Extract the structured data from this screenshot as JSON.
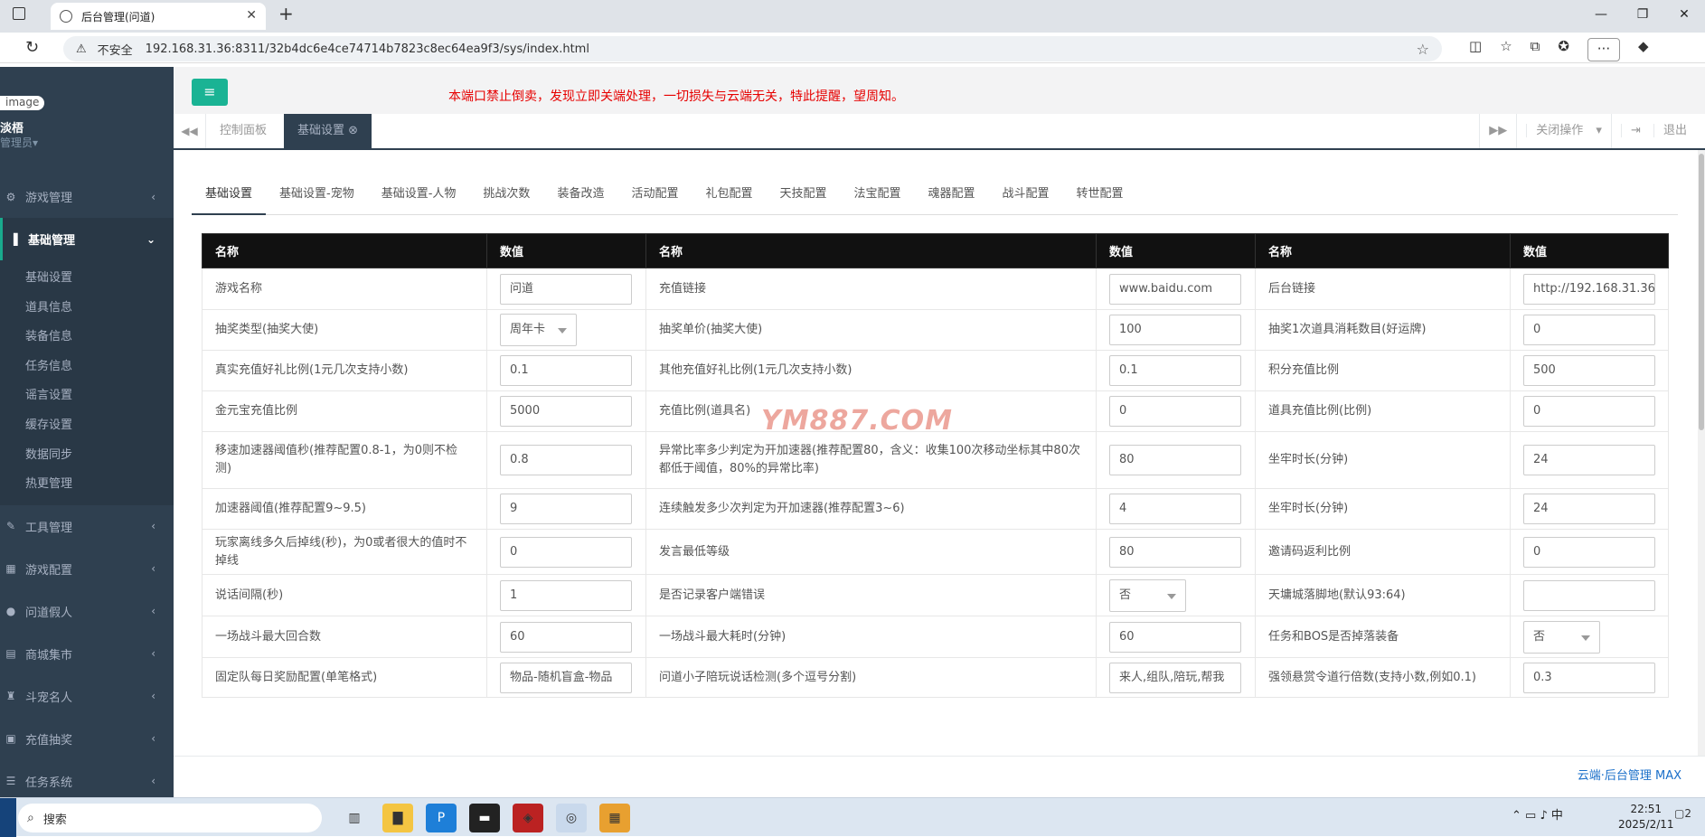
{
  "browser": {
    "tab_title": "后台管理(问道)",
    "security_label": "不安全",
    "url": "192.168.31.36:8311/32b4dc6e4ce74714b7823c8ec64ea9f3/sys/index.html"
  },
  "sidebar": {
    "avatar_alt": "image",
    "user_name": "淡梧",
    "user_role": "管理员",
    "menu": [
      {
        "label": "游戏管理"
      },
      {
        "label": "基础管理"
      },
      {
        "label": "工具管理"
      },
      {
        "label": "游戏配置"
      },
      {
        "label": "问道假人"
      },
      {
        "label": "商城集市"
      },
      {
        "label": "斗宠名人"
      },
      {
        "label": "充值抽奖"
      },
      {
        "label": "任务系统"
      }
    ],
    "submenu": [
      "基础设置",
      "道具信息",
      "装备信息",
      "任务信息",
      "谣言设置",
      "缓存设置",
      "数据同步",
      "热更管理"
    ]
  },
  "header": {
    "notice": "本端口禁止倒卖，发现立即关端处理，一切损失与云端无关，特此提醒，望周知。"
  },
  "page_tabs": {
    "items": [
      "控制面板",
      "基础设置"
    ],
    "close_ops": "关闭操作",
    "logout": "退出"
  },
  "subtabs": [
    "基础设置",
    "基础设置-宠物",
    "基础设置-人物",
    "挑战次数",
    "装备改造",
    "活动配置",
    "礼包配置",
    "天技配置",
    "法宝配置",
    "魂器配置",
    "战斗配置",
    "转世配置"
  ],
  "table": {
    "headers": [
      "名称",
      "数值",
      "名称",
      "数值",
      "名称",
      "数值"
    ],
    "rows": [
      [
        {
          "t": "游戏名称"
        },
        {
          "v": "问道"
        },
        {
          "t": "充值链接"
        },
        {
          "v": "www.baidu.com"
        },
        {
          "t": "后台链接"
        },
        {
          "v": "http://192.168.31.36"
        }
      ],
      [
        {
          "t": "抽奖类型(抽奖大使)"
        },
        {
          "s": "周年卡"
        },
        {
          "t": "抽奖单价(抽奖大使)"
        },
        {
          "v": "100"
        },
        {
          "t": "抽奖1次道具消耗数目(好运牌)"
        },
        {
          "v": "0"
        }
      ],
      [
        {
          "t": "真实充值好礼比例(1元几次支持小数)"
        },
        {
          "v": "0.1"
        },
        {
          "t": "其他充值好礼比例(1元几次支持小数)"
        },
        {
          "v": "0.1"
        },
        {
          "t": "积分充值比例"
        },
        {
          "v": "500"
        }
      ],
      [
        {
          "t": "金元宝充值比例"
        },
        {
          "v": "5000"
        },
        {
          "t": "充值比例(道具名)"
        },
        {
          "v": "0"
        },
        {
          "t": "道具充值比例(比例)"
        },
        {
          "v": "0"
        }
      ],
      [
        {
          "t": "移速加速器阈值秒(推荐配置0.8-1，为0则不检测)"
        },
        {
          "v": "0.8"
        },
        {
          "t": "异常比率多少判定为开加速器(推荐配置80，含义：收集100次移动坐标其中80次都低于阈值，80%的异常比率)"
        },
        {
          "v": "80"
        },
        {
          "t": "坐牢时长(分钟)"
        },
        {
          "v": "24"
        }
      ],
      [
        {
          "t": "加速器阈值(推荐配置9~9.5)"
        },
        {
          "v": "9"
        },
        {
          "t": "连续触发多少次判定为开加速器(推荐配置3~6)"
        },
        {
          "v": "4"
        },
        {
          "t": "坐牢时长(分钟)"
        },
        {
          "v": "24"
        }
      ],
      [
        {
          "t": "玩家离线多久后掉线(秒)，为0或者很大的值时不掉线"
        },
        {
          "v": "0"
        },
        {
          "t": "发言最低等级"
        },
        {
          "v": "80"
        },
        {
          "t": "邀请码返利比例"
        },
        {
          "v": "0"
        }
      ],
      [
        {
          "t": "说话间隔(秒)"
        },
        {
          "v": "1"
        },
        {
          "t": "是否记录客户端错误"
        },
        {
          "s": "否"
        },
        {
          "t": "天墉城落脚地(默认93:64)"
        },
        {
          "v": ""
        }
      ],
      [
        {
          "t": "一场战斗最大回合数"
        },
        {
          "v": "60"
        },
        {
          "t": "一场战斗最大耗时(分钟)"
        },
        {
          "v": "60"
        },
        {
          "t": "任务和BOS是否掉落装备"
        },
        {
          "s": "否"
        }
      ],
      [
        {
          "t": "固定队每日奖励配置(单笔格式)"
        },
        {
          "v": "物品-随机盲盒-物品"
        },
        {
          "t": "问道小子陪玩说话检测(多个逗号分割)"
        },
        {
          "v": "来人,组队,陪玩,帮我"
        },
        {
          "t": "强领悬赏令道行倍数(支持小数,例如0.1)"
        },
        {
          "v": "0.3"
        }
      ]
    ]
  },
  "watermark": "YM887.COM",
  "footer": {
    "brand": "云端·后台管理 MAX"
  },
  "taskbar": {
    "search_placeholder": "搜索",
    "ime": "中",
    "time": "22:51",
    "date": "2025/2/11",
    "notifications": "2"
  },
  "colors": {
    "sidebar": "#2f4050",
    "accent": "#1ab394",
    "notice": "#e60000"
  }
}
